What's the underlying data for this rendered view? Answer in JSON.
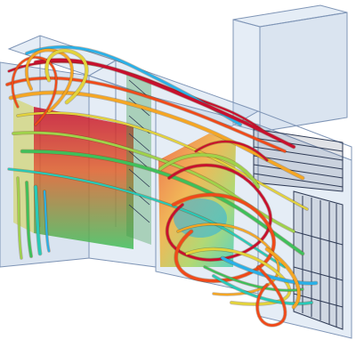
{
  "figure": {
    "kind": "3d-streamline-visualization",
    "colormap": [
      "#c8102e",
      "#f04a1a",
      "#f5a623",
      "#e3d33a",
      "#9fd24a",
      "#3fbf5a",
      "#28c9b8",
      "#2ab0e8"
    ],
    "housing_color": "#aac3e1",
    "housing_edge_color": "#7f95b6",
    "equipment_color": "#2e3a55"
  }
}
